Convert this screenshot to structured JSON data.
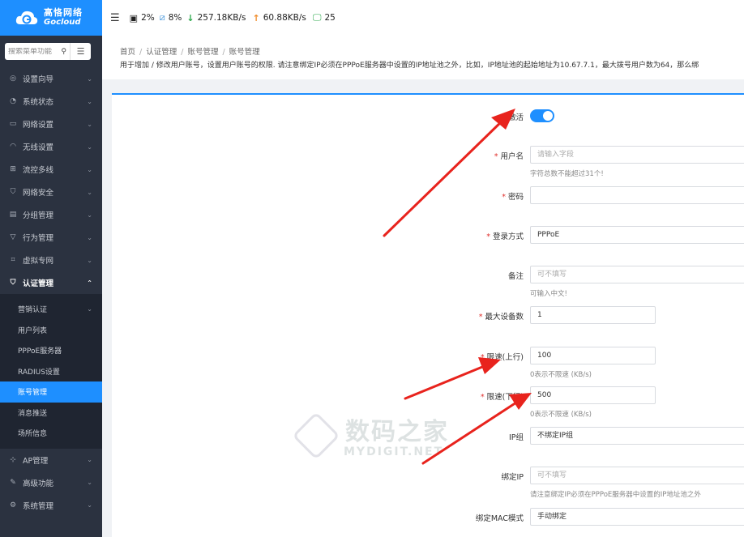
{
  "brand": {
    "name_cn": "高恪网络",
    "name_en": "Gocloud"
  },
  "sidebar": {
    "search_placeholder": "搜索菜单功能",
    "items": [
      {
        "label": "设置向导",
        "icon": "compass-icon"
      },
      {
        "label": "系统状态",
        "icon": "dashboard-icon"
      },
      {
        "label": "网络设置",
        "icon": "monitor-icon"
      },
      {
        "label": "无线设置",
        "icon": "wifi-icon"
      },
      {
        "label": "流控多线",
        "icon": "network-icon"
      },
      {
        "label": "网络安全",
        "icon": "shield-icon"
      },
      {
        "label": "分组管理",
        "icon": "list-icon"
      },
      {
        "label": "行为管理",
        "icon": "filter-icon"
      },
      {
        "label": "虚拟专网",
        "icon": "vpn-icon"
      },
      {
        "label": "认证管理",
        "icon": "shield-check-icon"
      }
    ],
    "sub_items": [
      {
        "label": "营销认证"
      },
      {
        "label": "用户列表"
      },
      {
        "label": "PPPoE服务器"
      },
      {
        "label": "RADIUS设置"
      },
      {
        "label": "账号管理"
      },
      {
        "label": "消息推送"
      },
      {
        "label": "场所信息"
      }
    ],
    "bottom_items": [
      {
        "label": "AP管理",
        "icon": "ap-icon"
      },
      {
        "label": "高级功能",
        "icon": "pin-icon"
      },
      {
        "label": "系统管理",
        "icon": "gear-icon"
      }
    ]
  },
  "topbar": {
    "cpu": "2%",
    "memory": "8%",
    "download": "257.18KB/s",
    "upload": "60.88KB/s",
    "devices": "25"
  },
  "breadcrumb": [
    "首页",
    "认证管理",
    "账号管理",
    "账号管理"
  ],
  "description": "用于增加 / 修改用户账号，设置用户账号的权限. 请注意绑定IP必须在PPPoE服务器中设置的IP地址池之外，比如，IP地址池的起始地址为10.67.7.1，最大拨号用户数为64，那么绑",
  "form": {
    "enable_label": "激活",
    "enable_on": true,
    "username_label": "用户名",
    "username_placeholder": "请输入字段",
    "username_hint": "字符总数不能超过31个!",
    "password_label": "密码",
    "login_label": "登录方式",
    "login_value": "PPPoE",
    "note_label": "备注",
    "note_placeholder": "可不填写",
    "note_hint": "可输入中文!",
    "max_dev_label": "最大设备数",
    "max_dev_value": "1",
    "up_label": "限速(上行)",
    "up_value": "100",
    "up_hint": "0表示不限速 (KB/s)",
    "down_label": "限速(下行)",
    "down_value": "500",
    "down_hint": "0表示不限速 (KB/s)",
    "ipgroup_label": "IP组",
    "ipgroup_value": "不绑定IP组",
    "bindip_label": "绑定IP",
    "bindip_placeholder": "可不填写",
    "bindip_hint": "请注意绑定IP必须在PPPoE服务器中设置的IP地址池之外",
    "mac_label": "绑定MAC模式",
    "mac_value": "手动绑定"
  },
  "watermark": {
    "cn": "数码之家",
    "en": "MYDIGIT.NET"
  },
  "colors": {
    "accent": "#1e8fff",
    "sidebar": "#2b3240",
    "required": "#e0302d",
    "arrow": "#e8231d"
  }
}
